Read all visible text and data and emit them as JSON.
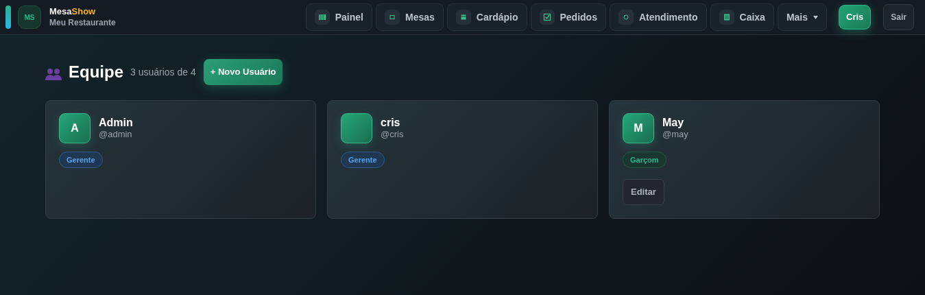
{
  "brand": {
    "initials": "MS",
    "name_start": "Mesa",
    "name_end": "Show",
    "subtitle": "Meu Restaurante"
  },
  "nav": [
    {
      "label": "Painel",
      "kind": "link"
    },
    {
      "label": "Mesas",
      "kind": "link"
    },
    {
      "label": "Cardápio",
      "kind": "link"
    },
    {
      "label": "Pedidos",
      "kind": "link"
    },
    {
      "label": "Atendimento",
      "kind": "link"
    },
    {
      "label": "Caixa",
      "kind": "link"
    },
    {
      "label": "Mais",
      "kind": "dropdown"
    }
  ],
  "user_button": "Cris",
  "logout_button": "Sair",
  "page": {
    "title": "Equipe",
    "count": "3 usuários de 4",
    "new_button": "+ Novo Usuário"
  },
  "users": [
    {
      "initial": "A",
      "name": "Admin",
      "username": "@admin",
      "role": {
        "label": "Gerente",
        "kind": "manager"
      }
    },
    {
      "name": "cris",
      "username": "@cris",
      "role": {
        "label": "Gerente",
        "kind": "manager"
      }
    },
    {
      "initial": "M",
      "name": "May",
      "username": "@may",
      "role": {
        "label": "Garçom",
        "kind": "waiter"
      },
      "actions": [
        "Editar"
      ]
    }
  ]
}
